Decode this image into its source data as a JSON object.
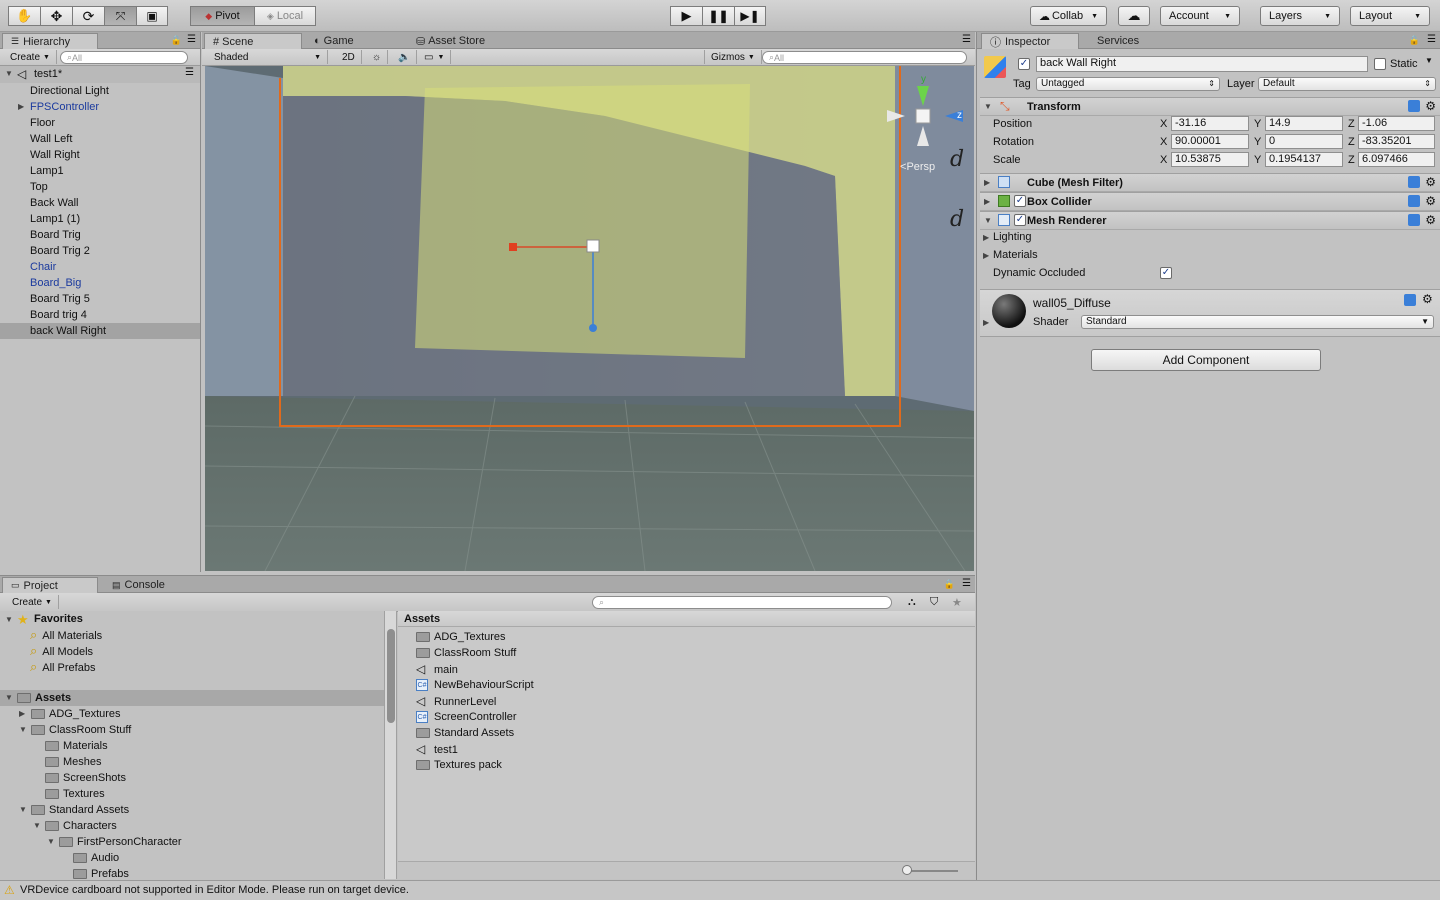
{
  "toolbar": {
    "pivot": "Pivot",
    "local": "Local",
    "collab": "Collab",
    "account": "Account",
    "layers": "Layers",
    "layout": "Layout"
  },
  "hierarchy": {
    "tab": "Hierarchy",
    "create": "Create",
    "search_placeholder": "All",
    "scene_name": "test1*",
    "items": [
      {
        "label": "Directional Light",
        "prefab": false
      },
      {
        "label": "FPSController",
        "prefab": true
      },
      {
        "label": "Floor",
        "prefab": false
      },
      {
        "label": "Wall Left",
        "prefab": false
      },
      {
        "label": "Wall Right",
        "prefab": false
      },
      {
        "label": "Lamp1",
        "prefab": false
      },
      {
        "label": "Top",
        "prefab": false
      },
      {
        "label": "Back Wall",
        "prefab": false
      },
      {
        "label": "Lamp1 (1)",
        "prefab": false
      },
      {
        "label": "Board Trig",
        "prefab": false
      },
      {
        "label": "Board Trig 2",
        "prefab": false
      },
      {
        "label": "Chair",
        "prefab": true
      },
      {
        "label": "Board_Big",
        "prefab": true
      },
      {
        "label": "Board Trig 5",
        "prefab": false
      },
      {
        "label": "Board trig 4",
        "prefab": false
      },
      {
        "label": "back Wall Right",
        "prefab": false
      }
    ]
  },
  "scene": {
    "tabs": [
      "Scene",
      "Game",
      "Asset Store"
    ],
    "shading": "Shaded",
    "mode_2d": "2D",
    "gizmos": "Gizmos",
    "search_placeholder": "All",
    "persp": "Persp",
    "gizmo_y": "y",
    "gizmo_z": "z"
  },
  "inspector": {
    "tabs": [
      "Inspector",
      "Services"
    ],
    "object_name": "back Wall Right",
    "static_label": "Static",
    "tag_label": "Tag",
    "tag_value": "Untagged",
    "layer_label": "Layer",
    "layer_value": "Default",
    "transform": {
      "title": "Transform",
      "position": {
        "label": "Position",
        "x": "-31.16",
        "y": "14.9",
        "z": "-1.06"
      },
      "rotation": {
        "label": "Rotation",
        "x": "90.00001",
        "y": "0",
        "z": "-83.35201"
      },
      "scale": {
        "label": "Scale",
        "x": "10.53875",
        "y": "0.1954137",
        "z": "6.097466"
      }
    },
    "axis_x": "X",
    "axis_y": "Y",
    "axis_z": "Z",
    "mesh_filter": "Cube (Mesh Filter)",
    "box_collider": "Box Collider",
    "mesh_renderer": "Mesh Renderer",
    "lighting": "Lighting",
    "materials": "Materials",
    "dynamic_occluded": "Dynamic Occluded",
    "material_name": "wall05_Diffuse",
    "shader_label": "Shader",
    "shader_value": "Standard",
    "add_component": "Add Component"
  },
  "project": {
    "tabs": [
      "Project",
      "Console"
    ],
    "create": "Create",
    "favorites_label": "Favorites",
    "favorites": [
      "All Materials",
      "All Models",
      "All Prefabs"
    ],
    "tree": [
      {
        "label": "Assets",
        "depth": 0,
        "open": true,
        "sel": true
      },
      {
        "label": "ADG_Textures",
        "depth": 1,
        "open": false
      },
      {
        "label": "ClassRoom Stuff",
        "depth": 1,
        "open": true
      },
      {
        "label": "Materials",
        "depth": 2
      },
      {
        "label": "Meshes",
        "depth": 2
      },
      {
        "label": "ScreenShots",
        "depth": 2
      },
      {
        "label": "Textures",
        "depth": 2
      },
      {
        "label": "Standard Assets",
        "depth": 1,
        "open": true
      },
      {
        "label": "Characters",
        "depth": 2,
        "open": true
      },
      {
        "label": "FirstPersonCharacter",
        "depth": 3,
        "open": true
      },
      {
        "label": "Audio",
        "depth": 4
      },
      {
        "label": "Prefabs",
        "depth": 4
      }
    ],
    "assets_header": "Assets",
    "assets": [
      {
        "label": "ADG_Textures",
        "kind": "folder"
      },
      {
        "label": "ClassRoom Stuff",
        "kind": "folder"
      },
      {
        "label": "main",
        "kind": "scene"
      },
      {
        "label": "NewBehaviourScript",
        "kind": "script"
      },
      {
        "label": "RunnerLevel",
        "kind": "scene"
      },
      {
        "label": "ScreenController",
        "kind": "script"
      },
      {
        "label": "Standard Assets",
        "kind": "folder"
      },
      {
        "label": "test1",
        "kind": "scene"
      },
      {
        "label": "Textures pack",
        "kind": "folder"
      }
    ]
  },
  "status": {
    "message": "VRDevice cardboard not supported in Editor Mode.  Please run on target device."
  }
}
